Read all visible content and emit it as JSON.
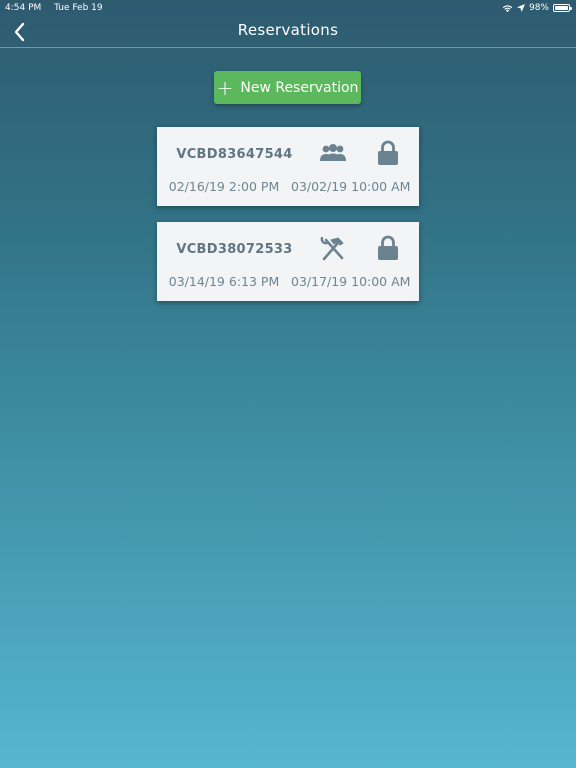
{
  "status_bar": {
    "time": "4:54 PM",
    "date": "Tue Feb 19",
    "battery": "98%",
    "battery_level": 0.98
  },
  "nav": {
    "title": "Reservations",
    "back_icon": "chevron-left-icon"
  },
  "new_reservation": {
    "label": "New Reservation",
    "icon": "plus-icon"
  },
  "reservations": [
    {
      "code": "VCBD83647544",
      "type_icon": "group-icon",
      "status_icon": "lock-icon",
      "start": "02/16/19 2:00 PM",
      "end": "03/02/19 10:00 AM"
    },
    {
      "code": "VCBD38072533",
      "type_icon": "tools-icon",
      "status_icon": "lock-icon",
      "start": "03/14/19 6:13 PM",
      "end": "03/17/19 10:00 AM"
    }
  ],
  "colors": {
    "accent_green": "#5cb85c",
    "card_bg": "#f2f4f6",
    "card_text": "#5f7684",
    "icon_color": "#6b8290"
  }
}
